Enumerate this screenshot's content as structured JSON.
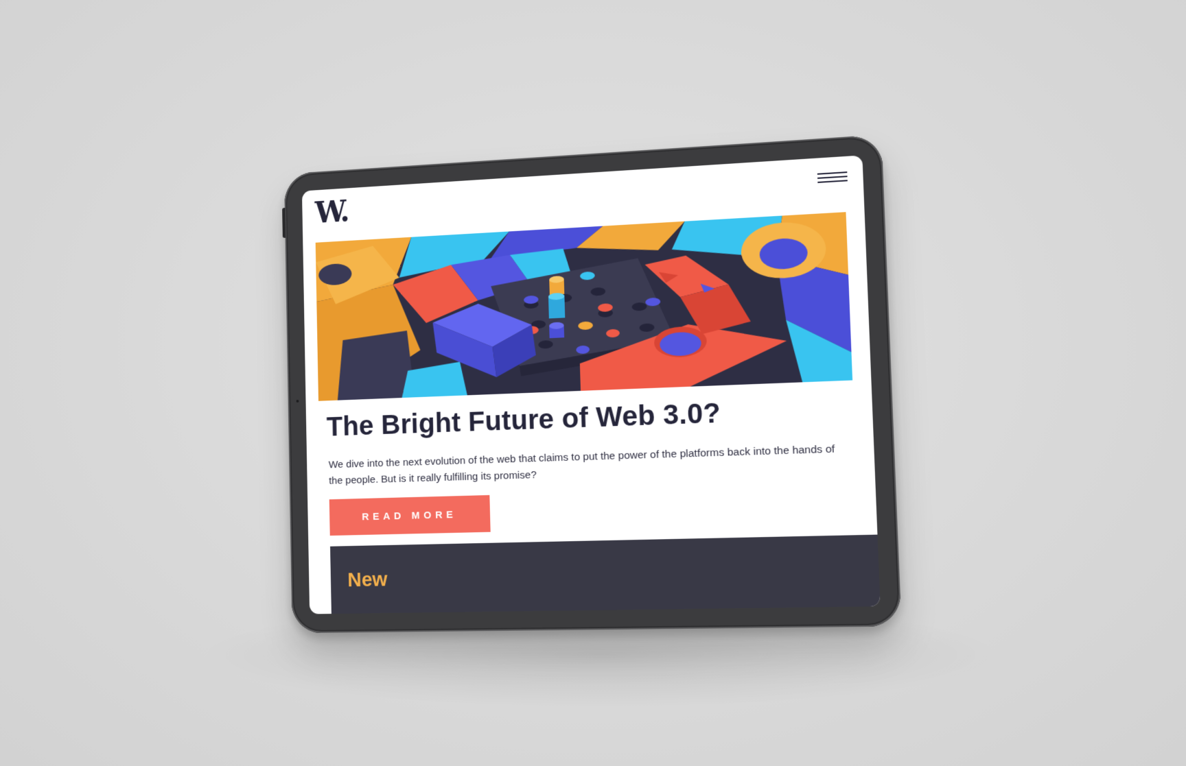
{
  "site": {
    "logo_text": "W.",
    "menu_icon": "hamburger-menu-icon"
  },
  "article": {
    "title": "The Bright Future of Web 3.0?",
    "description": "We dive into the next evolution of the web that claims to put the power of the platforms back into the hands of the people. But is it really fulfilling its promise?",
    "cta_label": "READ MORE"
  },
  "new_section": {
    "title": "New"
  },
  "colors": {
    "brand_dark": "#25253a",
    "cta": "#f36b5e",
    "panel": "#393946",
    "accent_yellow": "#f3b04c"
  }
}
